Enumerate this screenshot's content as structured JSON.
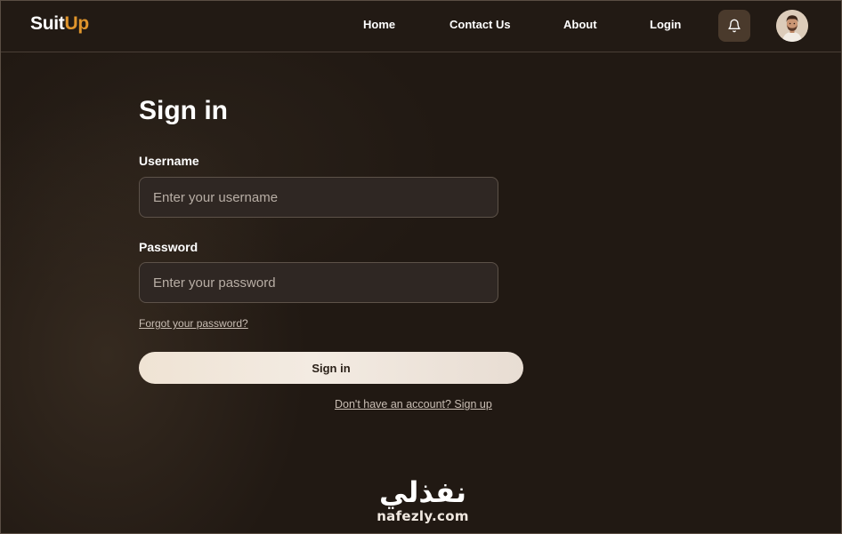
{
  "header": {
    "logo_part1": "Suit",
    "logo_part2": "Up",
    "nav": [
      "Home",
      "Contact Us",
      "About",
      "Login"
    ],
    "notification_icon": "bell-icon",
    "avatar_icon": "user-avatar"
  },
  "form": {
    "title": "Sign in",
    "username_label": "Username",
    "username_placeholder": "Enter your username",
    "username_value": "",
    "password_label": "Password",
    "password_placeholder": "Enter your password",
    "password_value": "",
    "forgot_link": "Forgot your password?",
    "submit_label": "Sign in",
    "signup_link": "Don't have an account? Sign up"
  },
  "watermark": {
    "arabic": "نفذلي",
    "latin": "nafezly.com"
  },
  "colors": {
    "background": "#211913",
    "accent": "#e0952c",
    "button": "#efe3d4"
  }
}
